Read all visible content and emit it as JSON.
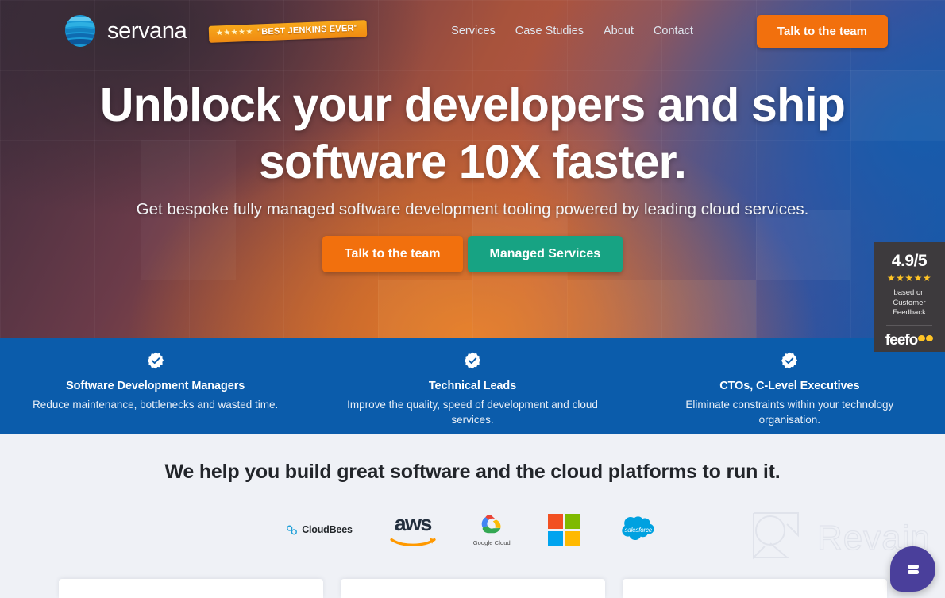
{
  "brand": {
    "name": "servana",
    "logo_icon": "servana-globe-icon",
    "accent_orange": "#f2700d",
    "accent_teal": "#17a383",
    "accent_blue": "#0b5cab"
  },
  "award_badge": {
    "stars": "★★★★★",
    "text": "\"BEST JENKINS EVER\""
  },
  "nav": {
    "items": [
      {
        "label": "Services"
      },
      {
        "label": "Case Studies"
      },
      {
        "label": "About"
      },
      {
        "label": "Contact"
      }
    ],
    "cta_label": "Talk to the team"
  },
  "hero": {
    "headline_line1": "Unblock your developers and ship",
    "headline_line2": "software 10X faster.",
    "subhead": "Get bespoke fully managed software development tooling powered by leading cloud services.",
    "primary_cta": "Talk to the team",
    "secondary_cta": "Managed Services"
  },
  "feefo": {
    "score": "4.9/5",
    "stars": "★★★★★",
    "based_on": "based on\nCustomer\nFeedback",
    "based_line1": "based on",
    "based_line2": "Customer",
    "based_line3": "Feedback",
    "logo_text": "feefo"
  },
  "audience_band": {
    "columns": [
      {
        "icon": "verified-badge-icon",
        "title": "Software Development Managers",
        "desc": "Reduce maintenance, bottlenecks and wasted time."
      },
      {
        "icon": "verified-badge-icon",
        "title": "Technical Leads",
        "desc": "Improve the quality, speed of development and cloud services."
      },
      {
        "icon": "verified-badge-icon",
        "title": "CTOs, C-Level Executives",
        "desc": "Eliminate constraints within your technology organisation."
      }
    ]
  },
  "partners": {
    "title": "We help you build great software and the cloud platforms to run it.",
    "logos": [
      {
        "name": "cloudbees-logo",
        "label": "CloudBees"
      },
      {
        "name": "aws-logo",
        "label": "aws"
      },
      {
        "name": "google-cloud-logo",
        "label": "Google Cloud"
      },
      {
        "name": "microsoft-logo",
        "label": ""
      },
      {
        "name": "salesforce-logo",
        "label": "salesforce"
      }
    ]
  },
  "watermark": {
    "text": "Revain",
    "icon": "revain-outline-icon"
  },
  "chat_widget": {
    "icon": "chat-bubble-icon",
    "color": "#4a3f9b"
  }
}
